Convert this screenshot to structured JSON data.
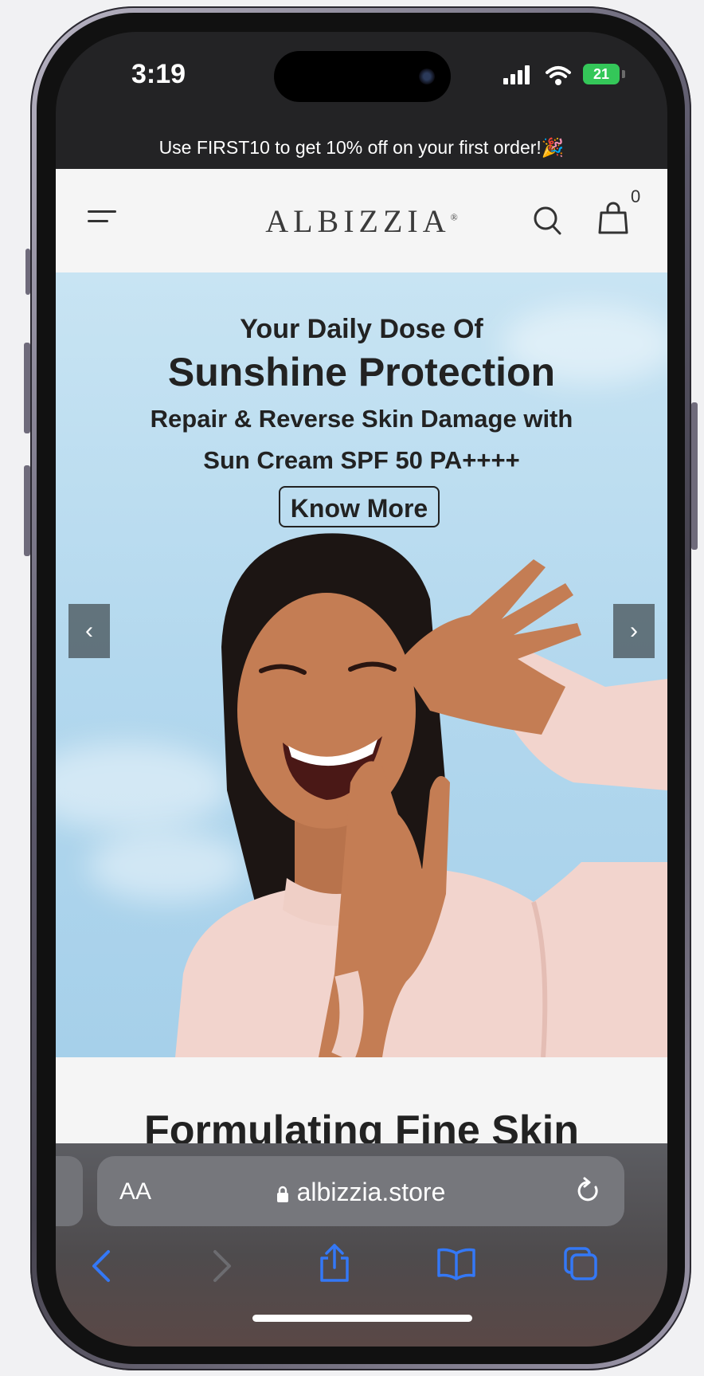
{
  "status_bar": {
    "time": "3:19",
    "battery": "21"
  },
  "promo_banner": {
    "text": "Use FIRST10 to get 10% off on your first order!🎉"
  },
  "header": {
    "logo": "ALBIZZIA",
    "logo_mark": "®",
    "cart_count": "0"
  },
  "hero": {
    "line1": "Your Daily Dose Of",
    "line2": "Sunshine Protection",
    "line3": "Repair & Reverse Skin Damage with",
    "line4": "Sun Cream SPF 50 PA++++",
    "cta_label": "Know More",
    "prev_arrow": "‹",
    "next_arrow": "›"
  },
  "section": {
    "title": "Formulating Fine Skin"
  },
  "browser": {
    "aa_label": "AA",
    "url": "albizzia.store"
  },
  "colors": {
    "accent_blue": "#3478f6",
    "battery_green": "#34c759"
  }
}
